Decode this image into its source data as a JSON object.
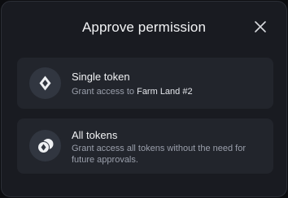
{
  "dialog": {
    "title": "Approve permission",
    "close_icon": "close-icon"
  },
  "options": [
    {
      "title": "Single token",
      "desc_prefix": "Grant access to ",
      "desc_highlight": "Farm Land #2",
      "icon": "single-token-icon"
    },
    {
      "title": "All tokens",
      "desc": "Grant access all tokens without the need for future approvals.",
      "icon": "all-tokens-icon"
    }
  ],
  "colors": {
    "background": "#0c0d10",
    "dialog": "#191b21",
    "card": "#22252c",
    "icon_bg": "#313640",
    "text": "#f2f3f5",
    "muted": "#9a9fab"
  }
}
